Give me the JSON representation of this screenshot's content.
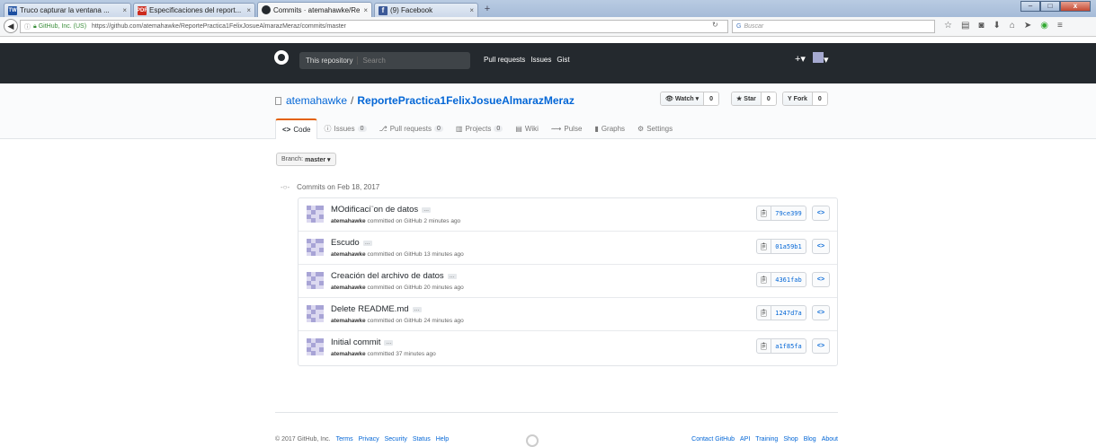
{
  "browser": {
    "tabs": [
      {
        "icon": "TW",
        "color": "#1d4fa0",
        "title": "Truco capturar la ventana ...",
        "close": "×"
      },
      {
        "icon": "PDF",
        "color": "#cc2a1e",
        "title": "Especificaciones del report...",
        "close": "×"
      },
      {
        "icon": "github-icon",
        "color": "#24292e",
        "title": "Commits · atemahawke/Re...",
        "close": "×"
      },
      {
        "icon": "f",
        "color": "#3b5998",
        "title": "(9) Facebook",
        "close": "×"
      }
    ],
    "new_tab": "+",
    "window": {
      "minimize": "–",
      "maximize": "□",
      "close": "x"
    },
    "url": {
      "org": "GitHub, Inc. (US)",
      "address": "https://github.com/atemahawke/ReportePractica1FelixJosueAlmarazMeraz/commits/master"
    },
    "search_placeholder": "Buscar",
    "search_engine": "G"
  },
  "header": {
    "search_scope": "This repository",
    "search_placeholder": "Search",
    "nav": [
      "Pull requests",
      "Issues",
      "Gist"
    ],
    "new_menu": "+▾"
  },
  "repo": {
    "owner": "atemahawke",
    "separator": "/",
    "name": "ReportePractica1FelixJosueAlmarazMeraz",
    "watch": {
      "label": "Watch ▾",
      "count": "0"
    },
    "star": {
      "label": "Star",
      "count": "0"
    },
    "fork": {
      "label": "Fork",
      "count": "0"
    }
  },
  "tabs": [
    {
      "label": "Code",
      "icon": "<>",
      "count": ""
    },
    {
      "label": "Issues",
      "icon": "ⓘ",
      "count": "0"
    },
    {
      "label": "Pull requests",
      "icon": "⎇",
      "count": "0"
    },
    {
      "label": "Projects",
      "icon": "▥",
      "count": "0"
    },
    {
      "label": "Wiki",
      "icon": "▤",
      "count": ""
    },
    {
      "label": "Pulse",
      "icon": "⟿",
      "count": ""
    },
    {
      "label": "Graphs",
      "icon": "▮",
      "count": ""
    },
    {
      "label": "Settings",
      "icon": "⚙",
      "count": ""
    }
  ],
  "branch": {
    "prefix": "Branch:",
    "name": "master ▾"
  },
  "commits_date": "Commits on Feb 18, 2017",
  "commits": [
    {
      "title": "MOdificaci¨on de datos",
      "author": "atemahawke",
      "meta": "committed on GitHub 2 minutes ago",
      "sha": "79ce399"
    },
    {
      "title": "Escudo",
      "author": "atemahawke",
      "meta": "committed on GitHub 13 minutes ago",
      "sha": "01a59b1"
    },
    {
      "title": "Creación del archivo de datos",
      "author": "atemahawke",
      "meta": "committed on GitHub 20 minutes ago",
      "sha": "4361fab"
    },
    {
      "title": "Delete README.md",
      "author": "atemahawke",
      "meta": "committed on GitHub 24 minutes ago",
      "sha": "1247d7a"
    },
    {
      "title": "Initial commit",
      "author": "atemahawke",
      "meta": "committed 37 minutes ago",
      "sha": "a1f85fa"
    }
  ],
  "ellipsis": "…",
  "browse_label": "<>",
  "footer": {
    "copyright": "© 2017 GitHub, Inc.",
    "left_links": [
      "Terms",
      "Privacy",
      "Security",
      "Status",
      "Help"
    ],
    "right_links": [
      "Contact GitHub",
      "API",
      "Training",
      "Shop",
      "Blog",
      "About"
    ]
  }
}
